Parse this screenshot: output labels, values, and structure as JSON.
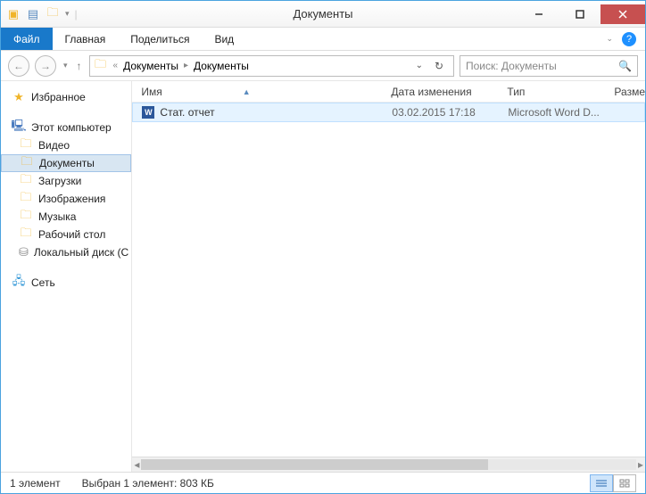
{
  "window": {
    "title": "Документы"
  },
  "ribbon": {
    "file": "Файл",
    "tabs": [
      "Главная",
      "Поделиться",
      "Вид"
    ]
  },
  "breadcrumb": {
    "items": [
      "Документы",
      "Документы"
    ]
  },
  "search": {
    "placeholder": "Поиск: Документы"
  },
  "nav": {
    "favorites": "Избранное",
    "computer": "Этот компьютер",
    "computer_items": [
      "Видео",
      "Документы",
      "Загрузки",
      "Изображения",
      "Музыка",
      "Рабочий стол",
      "Локальный диск (C"
    ],
    "network": "Сеть"
  },
  "columns": {
    "name": "Имя",
    "date": "Дата изменения",
    "type": "Тип",
    "size": "Разме"
  },
  "files": [
    {
      "name": "Стат. отчет",
      "date": "03.02.2015 17:18",
      "type": "Microsoft Word D..."
    }
  ],
  "status": {
    "count": "1 элемент",
    "selection": "Выбран 1 элемент: 803 КБ"
  }
}
